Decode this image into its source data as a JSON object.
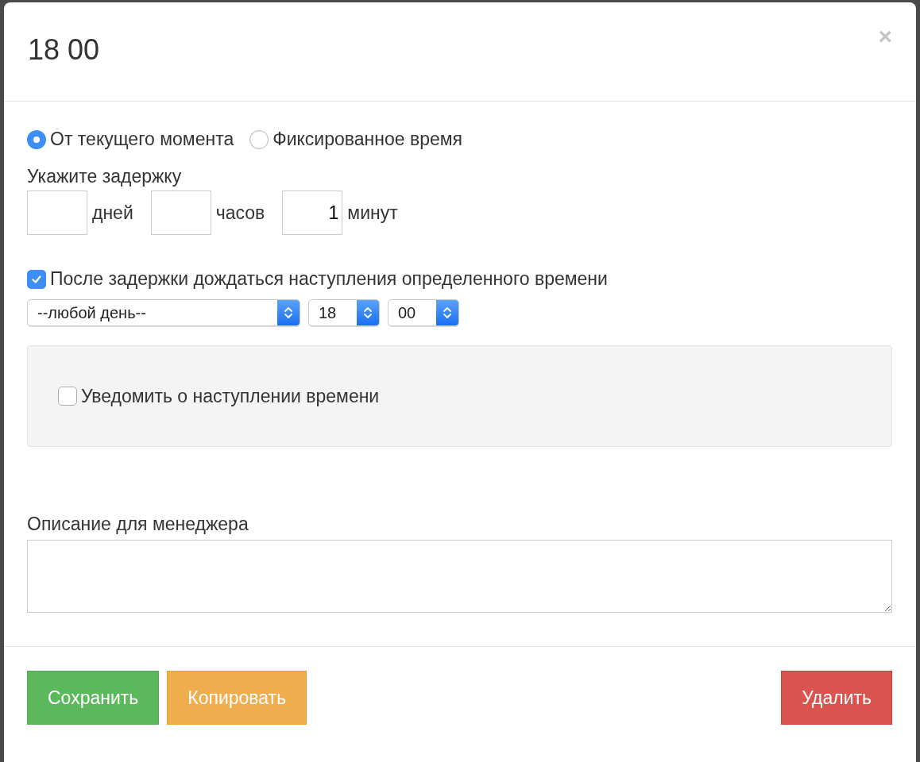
{
  "dialog": {
    "title": "18 00",
    "close": "×"
  },
  "mode_radios": [
    {
      "label": "От текущего момента",
      "selected": true
    },
    {
      "label": "Фиксированное время",
      "selected": false
    }
  ],
  "delay": {
    "label": "Укажите задержку",
    "fields": [
      {
        "unit": "дней"
      },
      {
        "unit": "часов"
      },
      {
        "value": "1",
        "unit": "минут"
      }
    ]
  },
  "wait_checkbox": {
    "label": "После задержки дождаться наступления определенного времени",
    "checked": true
  },
  "time_selects": [
    {
      "value": "--любой день--",
      "kind": "wide"
    },
    {
      "value": "18",
      "kind": "narrow"
    },
    {
      "value": "00",
      "kind": "narrow"
    }
  ],
  "notify_checkbox": {
    "label": "Уведомить о наступлении времени",
    "checked": false
  },
  "description": {
    "label": "Описание для менеджера"
  },
  "buttons": [
    {
      "label": "Сохранить",
      "kind": "success"
    },
    {
      "label": "Копировать",
      "kind": "warning"
    },
    {
      "label": "Удалить",
      "kind": "danger"
    }
  ]
}
